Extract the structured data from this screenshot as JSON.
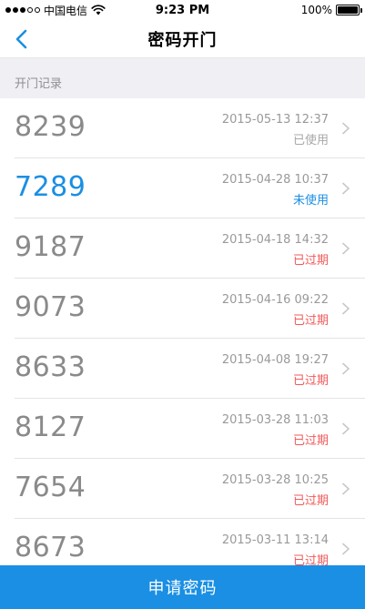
{
  "status_bar": {
    "carrier": "中国电信",
    "time": "9:23 PM",
    "battery": "100%"
  },
  "nav": {
    "title": "密码开门",
    "back_icon": "chevron-left-icon"
  },
  "section": {
    "title": "开门记录"
  },
  "records": [
    {
      "code": "8239",
      "datetime": "2015-05-13 12:37",
      "status": "已使用",
      "status_type": "used"
    },
    {
      "code": "7289",
      "datetime": "2015-04-28 10:37",
      "status": "未使用",
      "status_type": "unused"
    },
    {
      "code": "9187",
      "datetime": "2015-04-18 14:32",
      "status": "已过期",
      "status_type": "expired"
    },
    {
      "code": "9073",
      "datetime": "2015-04-16 09:22",
      "status": "已过期",
      "status_type": "expired"
    },
    {
      "code": "8633",
      "datetime": "2015-04-08 19:27",
      "status": "已过期",
      "status_type": "expired"
    },
    {
      "code": "8127",
      "datetime": "2015-03-28 11:03",
      "status": "已过期",
      "status_type": "expired"
    },
    {
      "code": "7654",
      "datetime": "2015-03-28 10:25",
      "status": "已过期",
      "status_type": "expired"
    },
    {
      "code": "8673",
      "datetime": "2015-03-11 13:14",
      "status": "已过期",
      "status_type": "expired"
    }
  ],
  "footer": {
    "apply_label": "申请密码"
  },
  "colors": {
    "accent": "#1a8fe3",
    "expired": "#f25a5a",
    "used": "#a8a8a8"
  }
}
